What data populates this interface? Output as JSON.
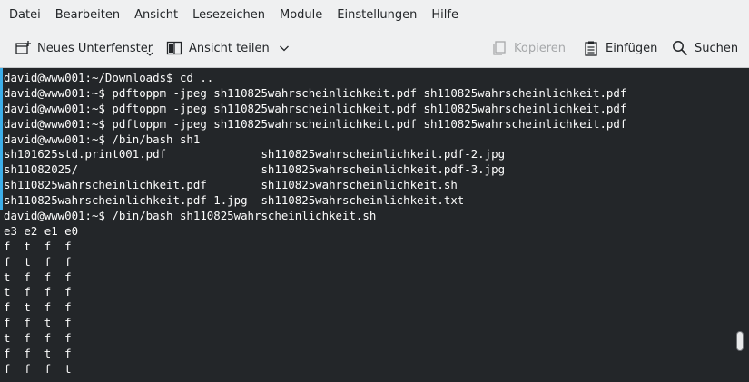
{
  "menubar": {
    "items": [
      "Datei",
      "Bearbeiten",
      "Ansicht",
      "Lesezeichen",
      "Module",
      "Einstellungen",
      "Hilfe"
    ]
  },
  "toolbar": {
    "new_tab_label": "Neues Unterfenster",
    "split_view_label": "Ansicht teilen",
    "copy_label": "Kopieren",
    "paste_label": "Einfügen",
    "search_label": "Suchen",
    "icons": {
      "new_tab": "new-tab-icon",
      "split_view": "split-view-icon",
      "dropdown": "chevron-down-icon",
      "copy": "copy-icon",
      "paste": "paste-icon",
      "search": "search-icon"
    }
  },
  "terminal": {
    "lines": [
      "david@www001:~/Downloads$ cd ..",
      "david@www001:~$ pdftoppm -jpeg sh110825wahrscheinlichkeit.pdf sh110825wahrscheinlichkeit.pdf",
      "david@www001:~$ pdftoppm -jpeg sh110825wahrscheinlichkeit.pdf sh110825wahrscheinlichkeit.pdf",
      "david@www001:~$ pdftoppm -jpeg sh110825wahrscheinlichkeit.pdf sh110825wahrscheinlichkeit.pdf",
      "david@www001:~$ /bin/bash sh1",
      "sh101625std.print001.pdf              sh110825wahrscheinlichkeit.pdf-2.jpg",
      "sh11082025/                           sh110825wahrscheinlichkeit.pdf-3.jpg",
      "sh110825wahrscheinlichkeit.pdf        sh110825wahrscheinlichkeit.sh",
      "sh110825wahrscheinlichkeit.pdf-1.jpg  sh110825wahrscheinlichkeit.txt",
      "david@www001:~$ /bin/bash sh110825wahrscheinlichkeit.sh",
      "e3 e2 e1 e0",
      "f  t  f  f",
      "f  t  f  f",
      "t  f  f  f",
      "t  f  f  f",
      "f  t  f  f",
      "f  f  t  f",
      "t  f  f  f",
      "f  f  t  f",
      "f  f  f  t"
    ],
    "colors": {
      "background": "#232629",
      "foreground": "#fcfcfc",
      "accent": "#3daee9"
    }
  }
}
